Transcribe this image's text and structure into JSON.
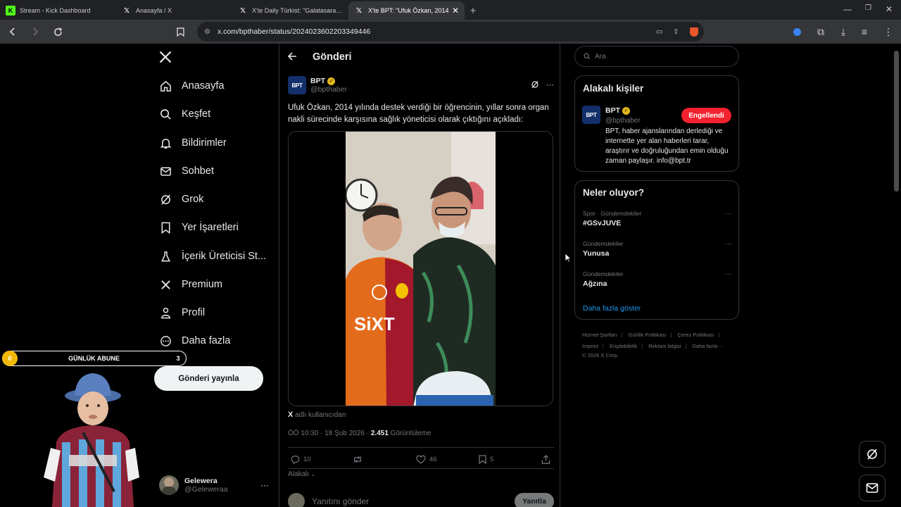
{
  "browser": {
    "tabs": [
      {
        "label": "Stream - Kick Dashboard",
        "icon": "kick-icon",
        "active": false
      },
      {
        "label": "Anasayfa / X",
        "icon": "x-icon",
        "active": false
      },
      {
        "label": "X'te Daily Türkist: \"Galatasaray-Juventus",
        "icon": "x-icon",
        "active": false
      },
      {
        "label": "X'te BPT: \"Ufuk Özkan, 2014",
        "icon": "x-icon",
        "active": true
      }
    ],
    "url": "x.com/bpthaber/status/2024023602203349446"
  },
  "nav": {
    "items": [
      {
        "label": "Anasayfa",
        "icon": "home-icon"
      },
      {
        "label": "Keşfet",
        "icon": "search-icon"
      },
      {
        "label": "Bildirimler",
        "icon": "bell-icon"
      },
      {
        "label": "Sohbet",
        "icon": "mail-icon"
      },
      {
        "label": "Grok",
        "icon": "grok-icon"
      },
      {
        "label": "Yer İşaretleri",
        "icon": "bookmark-icon"
      },
      {
        "label": "İçerik Üreticisi St...",
        "icon": "flask-icon"
      },
      {
        "label": "Premium",
        "icon": "x-icon"
      },
      {
        "label": "Profil",
        "icon": "person-icon"
      },
      {
        "label": "Daha fazla",
        "icon": "more-circle-icon"
      }
    ],
    "post_button": "Gönderi yayınla",
    "user": {
      "name": "Gelewera",
      "handle": "@Geleweraa"
    }
  },
  "overlay": {
    "sub_label": "GÜNLÜK ABUNE",
    "sub_left": "0",
    "sub_right": "3"
  },
  "post": {
    "header_title": "Gönderi",
    "author_name": "BPT",
    "author_handle": "@bpthaber",
    "logo_text": "BPT",
    "text": "Ufuk Özkan, 2014 yılında destek verdiği bir öğrencinin, yıllar sonra organ nakli sürecinde karşısına sağlık yöneticisi olarak çıktığını açıkladı:",
    "source_prefix": "X",
    "source_text": " adlı kullanıcıdan",
    "time": "ÖÖ 10:30 · 18 Şub 2026 · ",
    "views": "2.451",
    "views_label": " Görüntüleme",
    "stats": {
      "replies": "10",
      "reposts": "",
      "likes": "46",
      "bookmarks": "5"
    },
    "relevance": "Alakalı",
    "reply_placeholder": "Yanıtını gönder",
    "reply_button": "Yanıtla",
    "jersey_text": "SiXT"
  },
  "right": {
    "search_placeholder": "Ara",
    "related_title": "Alakalı kişiler",
    "related_user": {
      "name": "BPT",
      "handle": "@bpthaber",
      "button": "Engellendi",
      "bio": "BPT, haber ajanslarından derlediği ve internette yer alan haberleri tarar, araştırır ve doğruluğundan emin olduğu zaman paylaşır. info@bpt.tr"
    },
    "trends_title": "Neler oluyor?",
    "trends": [
      {
        "category": "Spor · Gündemdekiler",
        "title": "#GSvJUVE"
      },
      {
        "category": "Gündemdekiler",
        "title": "Yunusa"
      },
      {
        "category": "Gündemdekiler",
        "title": "Ağzına"
      }
    ],
    "show_more": "Daha fazla göster",
    "footer": [
      "Hizmet Şartları",
      "Gizlilik Politikası",
      "Çerez Politikası",
      "Imprint",
      "Erişilebilirlik",
      "Reklam bilgisi",
      "Daha fazla ···",
      "© 2026 X Corp."
    ]
  },
  "colors": {
    "accent": "#1d9bf0",
    "blocked": "#f4212e",
    "verified": "#e2b719",
    "background": "#000000"
  }
}
